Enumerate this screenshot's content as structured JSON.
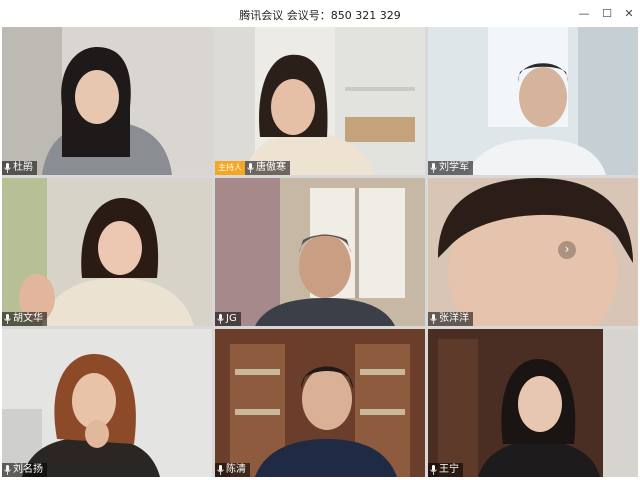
{
  "window": {
    "title": "腾讯会议 会议号：850 321 329",
    "controls": {
      "minimize_icon": "minimize-icon",
      "maximize_icon": "maximize-icon",
      "close_icon": "close-icon"
    }
  },
  "meeting": {
    "host_badge": "主持人",
    "participants": [
      {
        "name": "杜鹃"
      },
      {
        "name": "唐傲寒",
        "is_host": true
      },
      {
        "name": "刘学军"
      },
      {
        "name": "胡文华"
      },
      {
        "name": "JG"
      },
      {
        "name": "张洋洋"
      },
      {
        "name": "刘名扬"
      },
      {
        "name": "陈清"
      },
      {
        "name": "王宁"
      }
    ]
  },
  "colors": {
    "host_badge": "#f5a623",
    "name_tag_bg": "rgba(0,0,0,0.55)"
  }
}
